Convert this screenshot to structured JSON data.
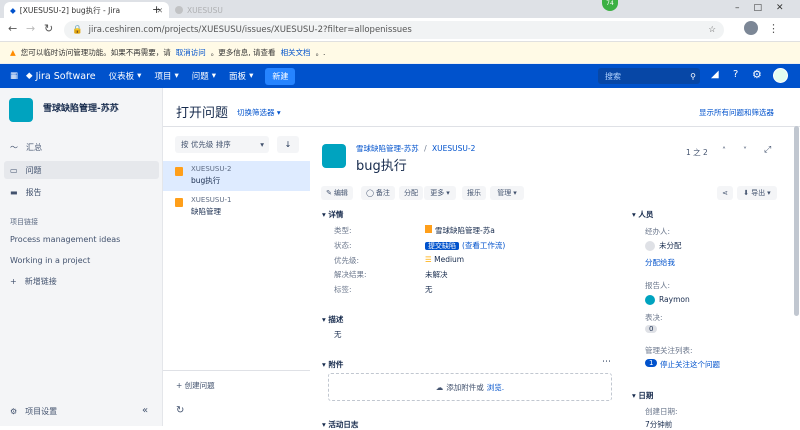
{
  "browser": {
    "tab_title": "[XUESUSU-2] bug执行 - Jira",
    "tab2_title": "XUESUSU",
    "url": "jira.ceshiren.com/projects/XUESUSU/issues/XUESUSU-2?filter=allopenissues",
    "badge": "74"
  },
  "warning": {
    "text1": "您可以临时访问管理功能。如果不再需要，请",
    "link1": "取消访问",
    "text2": "。更多信息, 请查看",
    "link2": "相关文档",
    "text3": "。."
  },
  "nav": {
    "logo": "Jira Software",
    "items": [
      "仪表板",
      "项目",
      "问题",
      "面板"
    ],
    "create": "新建",
    "search_placeholder": "搜索"
  },
  "sidebar": {
    "project_name": "雪球缺陷管理-苏苏",
    "items": [
      "汇总",
      "问题",
      "报告"
    ],
    "links_header": "项目链接",
    "links": [
      "Process management ideas",
      "Working in a project"
    ],
    "add_link": "新增链接",
    "settings": "项目设置"
  },
  "issues_header": {
    "title": "打开问题",
    "switch_filter": "切换筛选器",
    "show_all": "显示所有问题和筛选器"
  },
  "sort": {
    "label": "按 优先级 排序"
  },
  "issues": [
    {
      "key": "XUESUSU-2",
      "title": "bug执行"
    },
    {
      "key": "XUESUSU-1",
      "title": "缺陷管理"
    }
  ],
  "create_issue": "+ 创建问题",
  "detail": {
    "breadcrumb_project": "雪球缺陷管理-苏苏",
    "breadcrumb_sep": "/",
    "breadcrumb_key": "XUESUSU-2",
    "title": "bug执行",
    "pager": "1 之 2",
    "buttons": [
      "编辑",
      "备注",
      "分配",
      "更多",
      "报乐",
      "管理"
    ],
    "export": "导出",
    "details_label": "详情",
    "fields": [
      {
        "label": "类型:",
        "value": "雪球缺陷管理-苏a"
      },
      {
        "label": "状态:",
        "value": "提交缺陷",
        "extra": "(查看工作流)"
      },
      {
        "label": "优先级:",
        "value": "Medium"
      },
      {
        "label": "解决结果:",
        "value": "未解决"
      },
      {
        "label": "标签:",
        "value": "无"
      }
    ],
    "desc_label": "描述",
    "desc_value": "无",
    "attach_label": "附件",
    "attach_text": "添加附件或",
    "attach_link": "浏览.",
    "activity_label": "活动日志",
    "people": {
      "label": "人员",
      "assignee_label": "经办人:",
      "assignee": "未分配",
      "assign_me": "分配给我",
      "reporter_label": "报告人:",
      "reporter": "Raymon",
      "votes_label": "表决:",
      "votes": "0",
      "watchers_label": "管理关注列表:",
      "watchers": "1",
      "stop_watch": "停止关注这个问题"
    },
    "dates": {
      "label": "日期",
      "created_label": "创建日期:",
      "created": "7分钟前"
    }
  }
}
